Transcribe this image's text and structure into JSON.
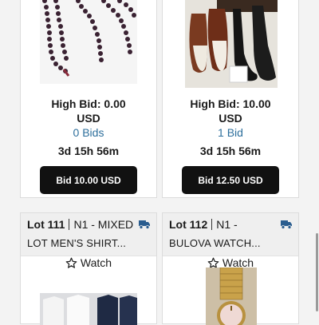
{
  "cards": [
    {
      "photo_alt": "pearl necklace",
      "high_bid": "High Bid: 0.00",
      "currency": "USD",
      "bids": "0 Bids",
      "time_left": "3d 15h 56m",
      "bid_button": "Bid 10.00 USD"
    },
    {
      "photo_alt": "shoes",
      "high_bid": "High Bid: 10.00",
      "currency": "USD",
      "bids": "1 Bid",
      "time_left": "3d 15h 56m",
      "bid_button": "Bid 12.50 USD"
    },
    {
      "lot": "Lot 111",
      "code": "N1 - MIXED",
      "title": "LOT MEN'S SHIRT...",
      "watch": "Watch"
    },
    {
      "lot": "Lot 112",
      "code": "N1 -",
      "title": "BULOVA WATCH...",
      "watch": "Watch"
    }
  ],
  "colors": {
    "bid_count": "#2d6f9c",
    "truck": "#2a5d8f",
    "button": "#111111"
  }
}
